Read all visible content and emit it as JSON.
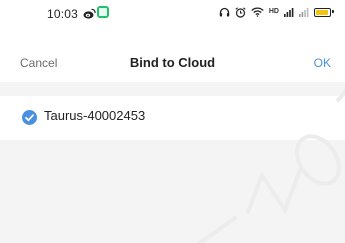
{
  "status_bar": {
    "time": "10:03",
    "hd_label": "HD",
    "icons": [
      "weibo-icon",
      "notification-icon",
      "headphones-icon",
      "alarm-icon",
      "wifi-icon",
      "hd-badge",
      "signal-icon",
      "signal-icon",
      "battery-icon"
    ],
    "battery_color": "#f2c30f"
  },
  "nav": {
    "cancel_label": "Cancel",
    "title": "Bind to Cloud",
    "ok_label": "OK",
    "ok_color": "#4a90e2"
  },
  "devices": [
    {
      "name": "Taurus-40002453",
      "selected": true,
      "check_color": "#4a90e2"
    }
  ]
}
